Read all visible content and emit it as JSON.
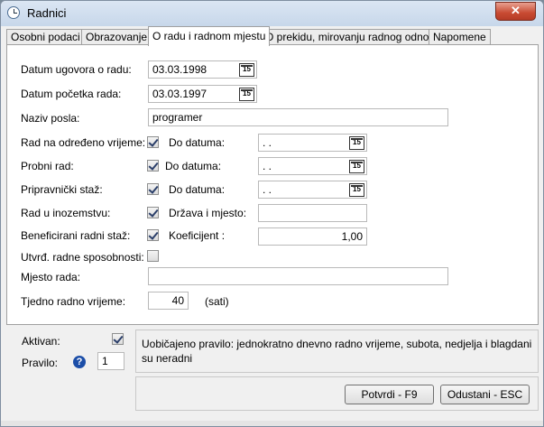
{
  "window": {
    "title": "Radnici",
    "close_glyph": "✕"
  },
  "tabs": [
    {
      "label": "Osobni podaci",
      "active": false
    },
    {
      "label": "Obrazovanje",
      "active": false
    },
    {
      "label": "O radu i radnom mjestu",
      "active": true
    },
    {
      "label": "O prekidu, mirovanju radnog odnosa",
      "active": false
    },
    {
      "label": "Napomene",
      "active": false
    }
  ],
  "form": {
    "datum_ugovora": {
      "label": "Datum ugovora o radu:",
      "value": "03.03.1998"
    },
    "datum_pocetka": {
      "label": "Datum početka rada:",
      "value": "03.03.1997"
    },
    "naziv_posla": {
      "label": "Naziv posla:",
      "value": "programer"
    },
    "rad_odredeno": {
      "label": "Rad na određeno vrijeme:",
      "checked": true,
      "sub_label": "Do datuma:",
      "value": " .  ."
    },
    "probni_rad": {
      "label": "Probni rad:",
      "checked": true,
      "sub_label": "Do datuma:",
      "value": " .  ."
    },
    "pripravnicki": {
      "label": "Pripravnički staž:",
      "checked": true,
      "sub_label": "Do datuma:",
      "value": " .  ."
    },
    "inozemstvo": {
      "label": "Rad u inozemstvu:",
      "checked": true,
      "sub_label": "Država i mjesto:",
      "value": ""
    },
    "beneficirani": {
      "label": "Beneficirani radni staž:",
      "checked": true,
      "sub_label": "Koeficijent :",
      "value": "1,00"
    },
    "sposobnosti": {
      "label": "Utvrđ. radne sposobnosti:",
      "checked": false
    },
    "mjesto_rada": {
      "label": "Mjesto rada:",
      "value": ""
    },
    "tjedno": {
      "label": "Tjedno radno vrijeme:",
      "value": "40",
      "unit": "(sati)"
    },
    "calendar_glyph": "15"
  },
  "footer": {
    "aktivan_label": "Aktivan:",
    "aktivan_checked": true,
    "pravilo_label": "Pravilo:",
    "pravilo_value": "1",
    "help_glyph": "?",
    "info_text": "Uobičajeno pravilo: jednokratno dnevno radno vrijeme, subota, nedjelja i blagdani su neradni",
    "confirm_label": "Potvrdi - F9",
    "cancel_label": "Odustani - ESC"
  }
}
